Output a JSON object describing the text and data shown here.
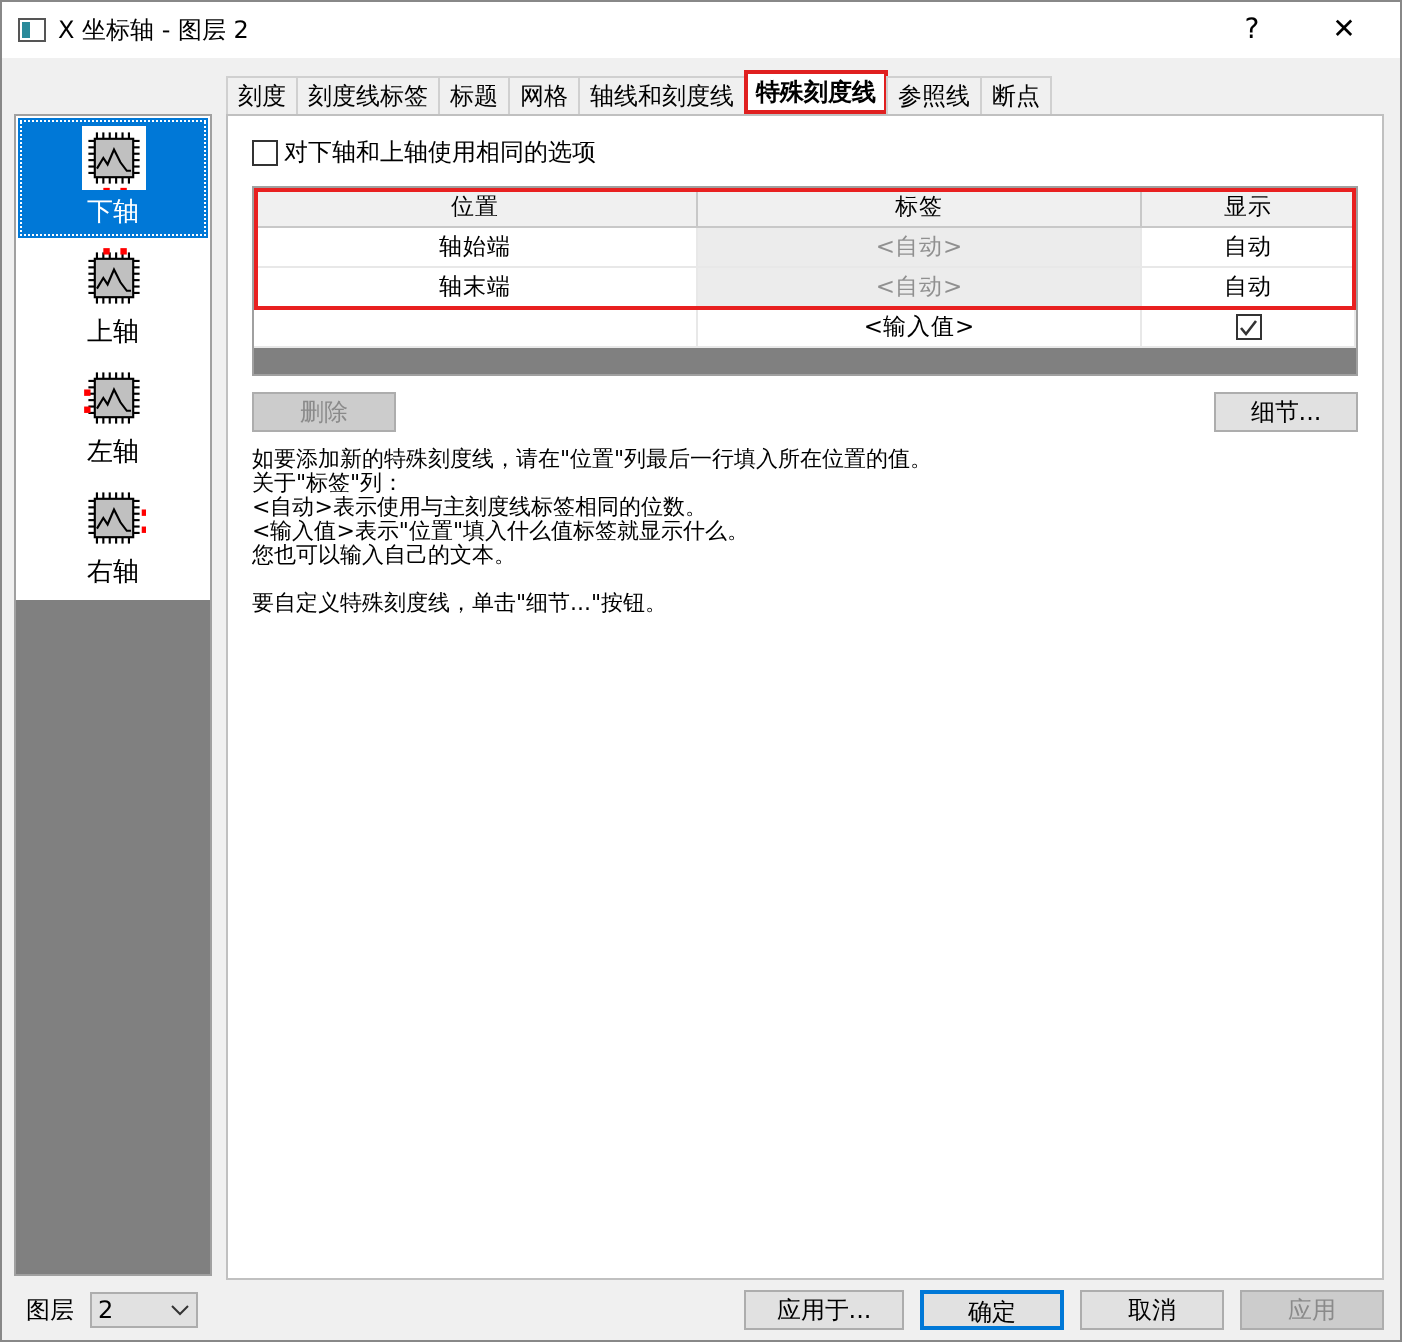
{
  "window": {
    "title": "X 坐标轴 - 图层 2",
    "help": "?",
    "close": "✕"
  },
  "tabs": [
    {
      "label": "刻度",
      "selected": false,
      "highlighted": false
    },
    {
      "label": "刻度线标签",
      "selected": false,
      "highlighted": false
    },
    {
      "label": "标题",
      "selected": false,
      "highlighted": false
    },
    {
      "label": "网格",
      "selected": false,
      "highlighted": false
    },
    {
      "label": "轴线和刻度线",
      "selected": false,
      "highlighted": false
    },
    {
      "label": "特殊刻度线",
      "selected": true,
      "highlighted": true
    },
    {
      "label": "参照线",
      "selected": false,
      "highlighted": false
    },
    {
      "label": "断点",
      "selected": false,
      "highlighted": false
    }
  ],
  "sidebar": {
    "items": [
      {
        "label": "下轴",
        "kind": "bottom",
        "selected": true
      },
      {
        "label": "上轴",
        "kind": "top",
        "selected": false
      },
      {
        "label": "左轴",
        "kind": "left",
        "selected": false
      },
      {
        "label": "右轴",
        "kind": "right",
        "selected": false
      }
    ]
  },
  "same_options": {
    "label": "对下轴和上轴使用相同的选项",
    "checked": false
  },
  "table": {
    "highlighted": true,
    "columns": [
      "位置",
      "标签",
      "显示"
    ],
    "rows": [
      {
        "position": "轴始端",
        "label": "<自动>",
        "label_disabled": true,
        "display": "自动"
      },
      {
        "position": "轴末端",
        "label": "<自动>",
        "label_disabled": true,
        "display": "自动"
      }
    ],
    "new_row": {
      "label": "<输入值>",
      "checked": true
    }
  },
  "delete_button": {
    "label": "删除",
    "disabled": true
  },
  "details_button": {
    "label": "细节..."
  },
  "help_paragraphs": [
    [
      "如要添加新的特殊刻度线，请在\"位置\"列最后一行填入所在位置的值。",
      "关于\"标签\"列：",
      "<自动>表示使用与主刻度线标签相同的位数。",
      "<输入值>表示\"位置\"填入什么值标签就显示什么。",
      "您也可以输入自己的文本。"
    ],
    [
      "要自定义特殊刻度线，单击\"细节...\"按钮。"
    ]
  ],
  "footer": {
    "layer_label": "图层",
    "layer_value": "2",
    "buttons": [
      {
        "label": "应用于...",
        "default": false,
        "disabled": false
      },
      {
        "label": "确定",
        "default": true,
        "disabled": false
      },
      {
        "label": "取消",
        "default": false,
        "disabled": false
      },
      {
        "label": "应用",
        "default": false,
        "disabled": true
      }
    ]
  }
}
